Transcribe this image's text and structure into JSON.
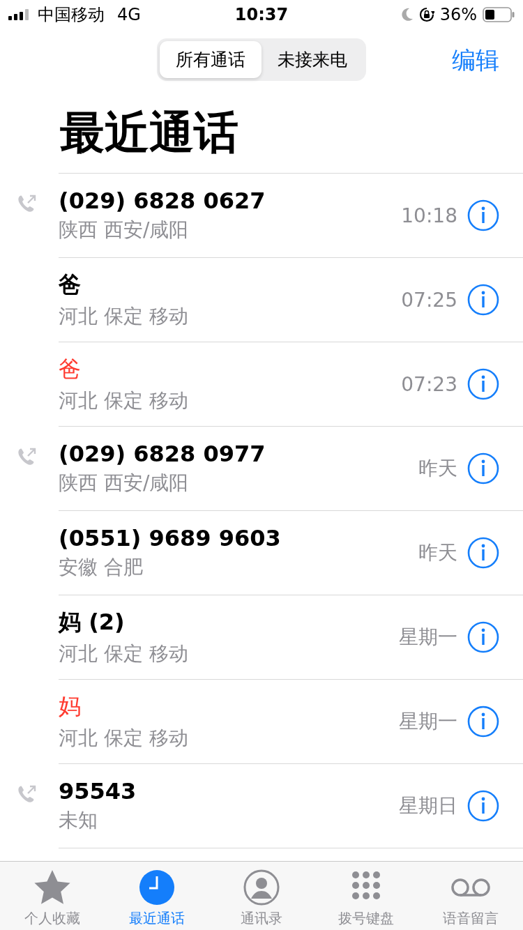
{
  "status_bar": {
    "carrier": "中国移动",
    "network": "4G",
    "time": "10:37",
    "battery": "36%"
  },
  "segments": [
    {
      "label": "所有通话",
      "selected": true
    },
    {
      "label": "未接来电",
      "selected": false
    }
  ],
  "edit": "编辑",
  "title": "最近通话",
  "calls": [
    {
      "name": "(029) 6828 0627",
      "location": "陕西 西安/咸阳",
      "time": "10:18",
      "missed": false,
      "outgoing": true
    },
    {
      "name": "爸",
      "location": "河北 保定 移动",
      "time": "07:25",
      "missed": false,
      "outgoing": false
    },
    {
      "name": "爸",
      "location": "河北 保定 移动",
      "time": "07:23",
      "missed": true,
      "outgoing": false
    },
    {
      "name": "(029) 6828 0977",
      "location": "陕西 西安/咸阳",
      "time": "昨天",
      "missed": false,
      "outgoing": true
    },
    {
      "name": "(0551) 9689 9603",
      "location": "安徽 合肥",
      "time": "昨天",
      "missed": false,
      "outgoing": false
    },
    {
      "name": "妈 (2)",
      "location": "河北 保定 移动",
      "time": "星期一",
      "missed": false,
      "outgoing": false
    },
    {
      "name": "妈",
      "location": "河北 保定 移动",
      "time": "星期一",
      "missed": true,
      "outgoing": false
    },
    {
      "name": "95543",
      "location": "未知",
      "time": "星期日",
      "missed": false,
      "outgoing": true
    }
  ],
  "tab_bar": [
    {
      "kind": "favorites",
      "label": "个人收藏",
      "selected": false
    },
    {
      "kind": "recents",
      "label": "最近通话",
      "selected": true
    },
    {
      "kind": "contacts",
      "label": "通讯录",
      "selected": false
    },
    {
      "kind": "keypad",
      "label": "拨号键盘",
      "selected": false
    },
    {
      "kind": "voicemail",
      "label": "语音留言",
      "selected": false
    }
  ]
}
